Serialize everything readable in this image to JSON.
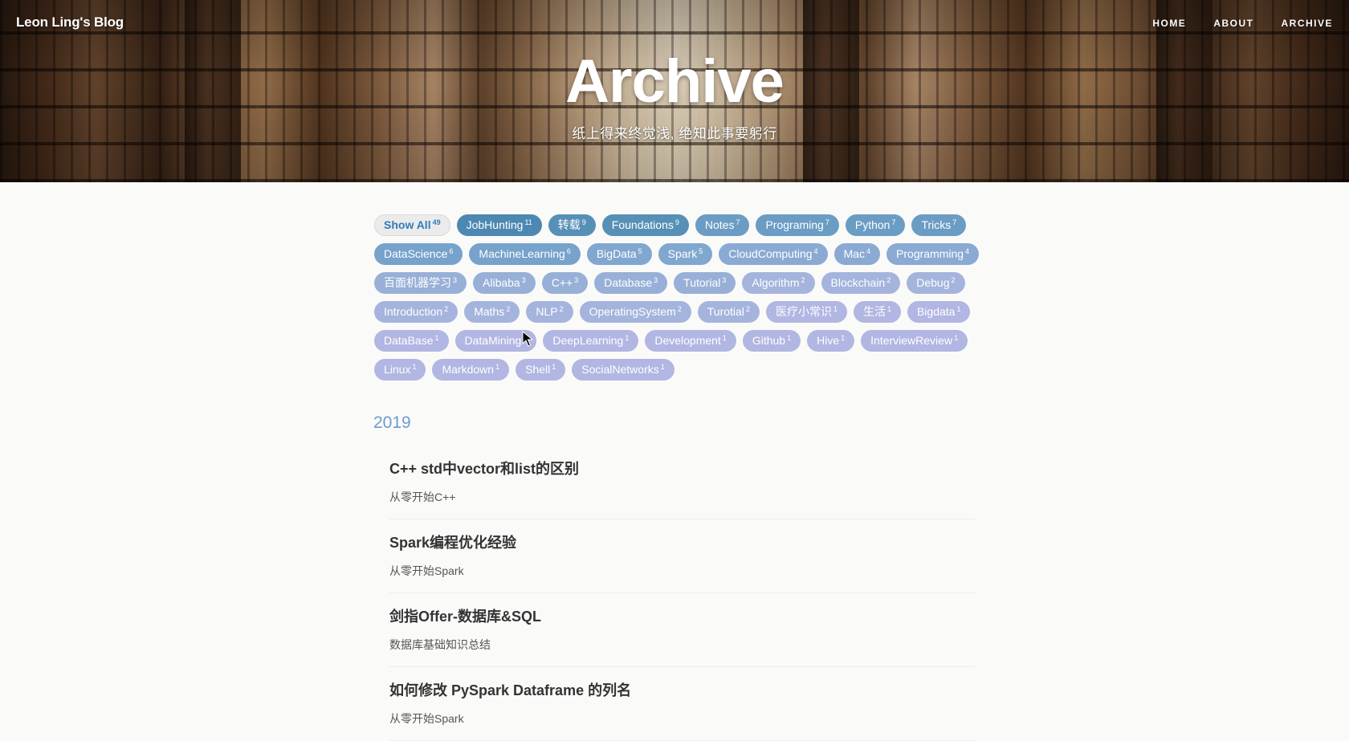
{
  "site": {
    "brand": "Leon Ling's Blog",
    "nav": [
      "HOME",
      "ABOUT",
      "ARCHIVE"
    ]
  },
  "hero": {
    "title": "Archive",
    "subtitle": "纸上得来终觉浅, 绝知此事要躬行"
  },
  "tags": [
    {
      "label": "Show All",
      "count": "49",
      "color": "#ebebeb"
    },
    {
      "label": "JobHunting",
      "count": "11",
      "color": "#4d88b2"
    },
    {
      "label": "转载",
      "count": "9",
      "color": "#5790b7"
    },
    {
      "label": "Foundations",
      "count": "9",
      "color": "#5790b7"
    },
    {
      "label": "Notes",
      "count": "7",
      "color": "#6b9cc4"
    },
    {
      "label": "Programing",
      "count": "7",
      "color": "#6b9cc4"
    },
    {
      "label": "Python",
      "count": "7",
      "color": "#6b9cc4"
    },
    {
      "label": "Tricks",
      "count": "7",
      "color": "#6b9cc4"
    },
    {
      "label": "DataScience",
      "count": "6",
      "color": "#76a2cb"
    },
    {
      "label": "MachineLearning",
      "count": "6",
      "color": "#76a2cb"
    },
    {
      "label": "BigData",
      "count": "5",
      "color": "#80a7cf"
    },
    {
      "label": "Spark",
      "count": "5",
      "color": "#80a7cf"
    },
    {
      "label": "CloudComputing",
      "count": "4",
      "color": "#8aaad3"
    },
    {
      "label": "Mac",
      "count": "4",
      "color": "#8aaad3"
    },
    {
      "label": "Programming",
      "count": "4",
      "color": "#8aaad3"
    },
    {
      "label": "百面机器学习",
      "count": "3",
      "color": "#98b0d8"
    },
    {
      "label": "Alibaba",
      "count": "3",
      "color": "#98b0d8"
    },
    {
      "label": "C++",
      "count": "3",
      "color": "#98b0d8"
    },
    {
      "label": "Database",
      "count": "3",
      "color": "#98b0d8"
    },
    {
      "label": "Tutorial",
      "count": "3",
      "color": "#98b0d8"
    },
    {
      "label": "Algorithm",
      "count": "2",
      "color": "#a5b4dd"
    },
    {
      "label": "Blockchain",
      "count": "2",
      "color": "#a5b4dd"
    },
    {
      "label": "Debug",
      "count": "2",
      "color": "#a5b4dd"
    },
    {
      "label": "Introduction",
      "count": "2",
      "color": "#a5b4dd"
    },
    {
      "label": "Maths",
      "count": "2",
      "color": "#a5b4dd"
    },
    {
      "label": "NLP",
      "count": "2",
      "color": "#a5b4dd"
    },
    {
      "label": "OperatingSystem",
      "count": "2",
      "color": "#a5b4dd"
    },
    {
      "label": "Turotial",
      "count": "2",
      "color": "#a5b4dd"
    },
    {
      "label": "医疗小常识",
      "count": "1",
      "color": "#b2b6e2"
    },
    {
      "label": "生活",
      "count": "1",
      "color": "#b2b6e2"
    },
    {
      "label": "Bigdata",
      "count": "1",
      "color": "#b2b6e2"
    },
    {
      "label": "DataBase",
      "count": "1",
      "color": "#b2b6e2"
    },
    {
      "label": "DataMining",
      "count": "1",
      "color": "#b2b6e2"
    },
    {
      "label": "DeepLearning",
      "count": "1",
      "color": "#b2b6e2"
    },
    {
      "label": "Development",
      "count": "1",
      "color": "#b2b6e2"
    },
    {
      "label": "Github",
      "count": "1",
      "color": "#b2b6e2"
    },
    {
      "label": "Hive",
      "count": "1",
      "color": "#b2b6e2"
    },
    {
      "label": "InterviewReview",
      "count": "1",
      "color": "#b2b6e2"
    },
    {
      "label": "Linux",
      "count": "1",
      "color": "#b2b6e2"
    },
    {
      "label": "Markdown",
      "count": "1",
      "color": "#b2b6e2"
    },
    {
      "label": "Shell",
      "count": "1",
      "color": "#b2b6e2"
    },
    {
      "label": "SocialNetworks",
      "count": "1",
      "color": "#b2b6e2"
    }
  ],
  "archive": {
    "year": "2019",
    "posts": [
      {
        "title": "C++ std中vector和list的区别",
        "subtitle": "从零开始C++"
      },
      {
        "title": "Spark编程优化经验",
        "subtitle": "从零开始Spark"
      },
      {
        "title": "剑指Offer-数据库&SQL",
        "subtitle": "数据库基础知识总结"
      },
      {
        "title": "如何修改 PySpark Dataframe 的列名",
        "subtitle": "从零开始Spark"
      }
    ]
  }
}
